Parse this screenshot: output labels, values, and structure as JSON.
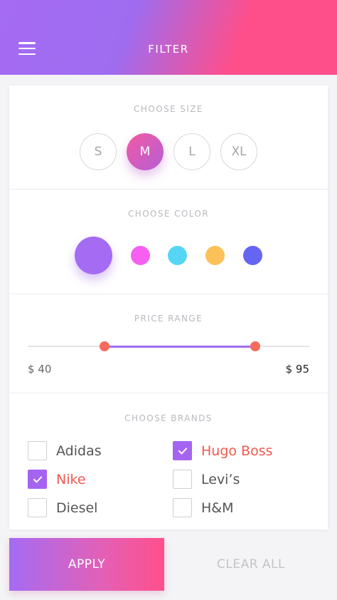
{
  "header": {
    "title": "FILTER",
    "menu_icon": "hamburger-menu-icon"
  },
  "size": {
    "title": "CHOOSE SIZE",
    "options": [
      {
        "label": "S",
        "selected": false
      },
      {
        "label": "M",
        "selected": true
      },
      {
        "label": "L",
        "selected": false
      },
      {
        "label": "XL",
        "selected": false
      }
    ]
  },
  "color": {
    "title": "CHOOSE COLOR",
    "swatches": [
      {
        "name": "purple",
        "hex": "#a56bf3",
        "selected": true
      },
      {
        "name": "pink",
        "hex": "#f65ff0",
        "selected": false
      },
      {
        "name": "cyan",
        "hex": "#56d6f5",
        "selected": false
      },
      {
        "name": "yellow",
        "hex": "#fcc159",
        "selected": false
      },
      {
        "name": "blue",
        "hex": "#6565f4",
        "selected": false
      }
    ]
  },
  "price": {
    "title": "PRICE RANGE",
    "min_label": "$ 40",
    "max_label": "$ 95"
  },
  "brands": {
    "title": "CHOOSE BRANDS",
    "items": [
      {
        "label": "Adidas",
        "checked": false
      },
      {
        "label": "Hugo Boss",
        "checked": true
      },
      {
        "label": "Nike",
        "checked": true
      },
      {
        "label": "Levi’s",
        "checked": false
      },
      {
        "label": "Diesel",
        "checked": false
      },
      {
        "label": "H&M",
        "checked": false
      }
    ]
  },
  "actions": {
    "apply_label": "APPLY",
    "clear_label": "CLEAR ALL"
  },
  "colors": {
    "accent": "#a564ef",
    "highlight": "#f2574e",
    "brand_pink": "#ff4f8b"
  }
}
